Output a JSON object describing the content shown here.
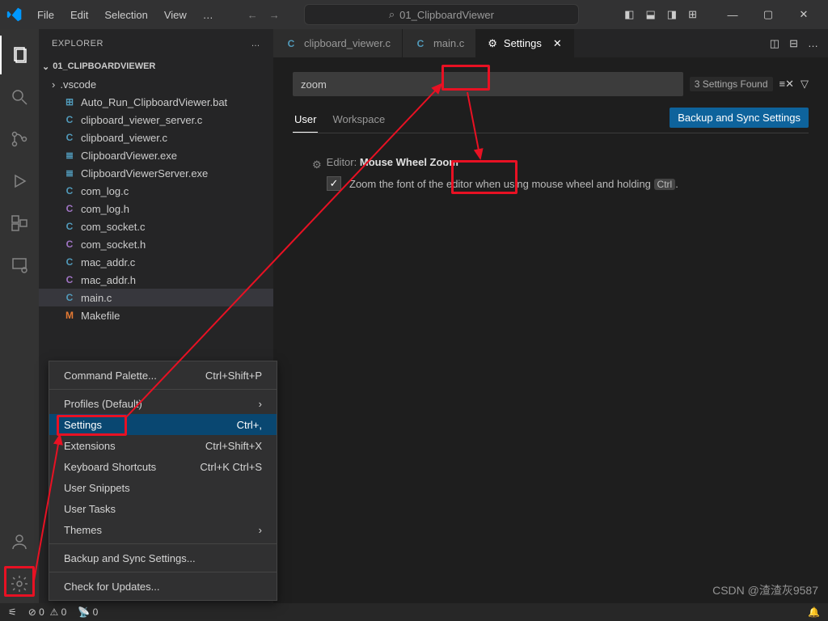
{
  "titlebar": {
    "menus": [
      "File",
      "Edit",
      "Selection",
      "View"
    ],
    "search": "01_ClipboardViewer"
  },
  "explorer": {
    "title": "EXPLORER",
    "project": "01_CLIPBOARDVIEWER",
    "items": [
      {
        "icon": "chev",
        "cls": "",
        "label": ".vscode",
        "indent": false,
        "folder": true
      },
      {
        "icon": "bat",
        "cls": "ic-bat",
        "label": "Auto_Run_ClipboardViewer.bat"
      },
      {
        "icon": "C",
        "cls": "ic-c",
        "label": "clipboard_viewer_server.c"
      },
      {
        "icon": "C",
        "cls": "ic-c",
        "label": "clipboard_viewer.c"
      },
      {
        "icon": "exe",
        "cls": "ic-exe",
        "label": "ClipboardViewer.exe"
      },
      {
        "icon": "exe",
        "cls": "ic-exe",
        "label": "ClipboardViewerServer.exe"
      },
      {
        "icon": "C",
        "cls": "ic-c",
        "label": "com_log.c"
      },
      {
        "icon": "C",
        "cls": "ic-h",
        "label": "com_log.h"
      },
      {
        "icon": "C",
        "cls": "ic-c",
        "label": "com_socket.c"
      },
      {
        "icon": "C",
        "cls": "ic-h",
        "label": "com_socket.h"
      },
      {
        "icon": "C",
        "cls": "ic-c",
        "label": "mac_addr.c"
      },
      {
        "icon": "C",
        "cls": "ic-h",
        "label": "mac_addr.h"
      },
      {
        "icon": "C",
        "cls": "ic-c",
        "label": "main.c",
        "selected": true
      },
      {
        "icon": "M",
        "cls": "ic-m",
        "label": "Makefile"
      }
    ]
  },
  "context_menu": [
    {
      "label": "Command Palette...",
      "accel": "Ctrl+Shift+P"
    },
    {
      "sep": true
    },
    {
      "label": "Profiles (Default)",
      "chev": true
    },
    {
      "label": "Settings",
      "accel": "Ctrl+,",
      "highlight": true
    },
    {
      "label": "Extensions",
      "accel": "Ctrl+Shift+X"
    },
    {
      "label": "Keyboard Shortcuts",
      "accel": "Ctrl+K Ctrl+S"
    },
    {
      "label": "User Snippets"
    },
    {
      "label": "User Tasks"
    },
    {
      "label": "Themes",
      "chev": true
    },
    {
      "sep": true
    },
    {
      "label": "Backup and Sync Settings..."
    },
    {
      "sep": true
    },
    {
      "label": "Check for Updates..."
    }
  ],
  "tabs": [
    {
      "icon": "C",
      "cls": "ic-c",
      "label": "clipboard_viewer.c"
    },
    {
      "icon": "C",
      "cls": "ic-c",
      "label": "main.c"
    },
    {
      "icon": "gear",
      "label": "Settings",
      "active": true,
      "close": true
    }
  ],
  "settings": {
    "search": "zoom",
    "found": "3 Settings Found",
    "scopes": [
      "User",
      "Workspace"
    ],
    "sync": "Backup and Sync Settings",
    "item": {
      "cat": "Editor:",
      "name": "Mouse Wheel Zoom",
      "desc_pre": "Zoom the font of the editor when using mouse wheel and holding",
      "kbd": "Ctrl",
      "desc_post": "."
    }
  },
  "status": {
    "errors": "0",
    "warnings": "0",
    "ports": "0"
  },
  "watermark": "CSDN @渣渣灰9587"
}
